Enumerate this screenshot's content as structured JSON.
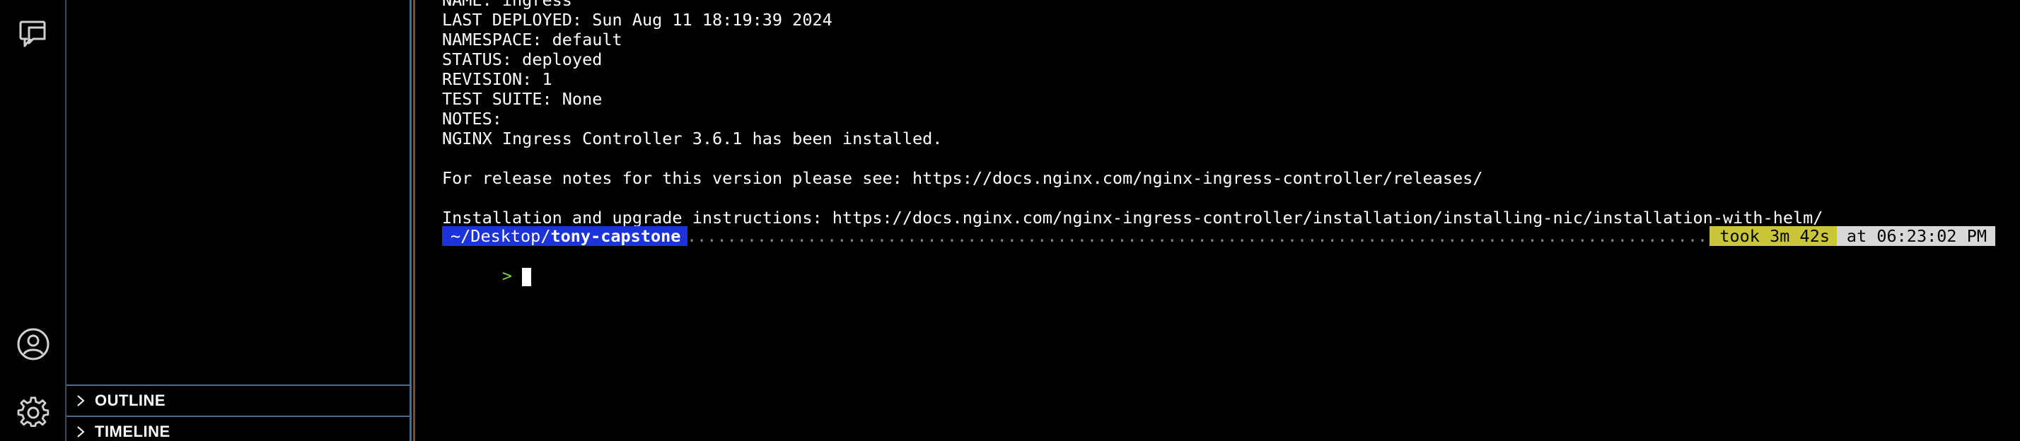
{
  "activity_bar": {
    "icons": [
      "chat-icon",
      "account-icon",
      "settings-icon"
    ]
  },
  "side_panel": {
    "sections": [
      {
        "label": "OUTLINE"
      },
      {
        "label": "TIMELINE"
      }
    ]
  },
  "terminal": {
    "lines": [
      "NAME: ingress",
      "LAST DEPLOYED: Sun Aug 11 18:19:39 2024",
      "NAMESPACE: default",
      "STATUS: deployed",
      "REVISION: 1",
      "TEST SUITE: None",
      "NOTES:",
      "NGINX Ingress Controller 3.6.1 has been installed.",
      "",
      "For release notes for this version please see: https://docs.nginx.com/nginx-ingress-controller/releases/",
      "",
      "Installation and upgrade instructions: https://docs.nginx.com/nginx-ingress-controller/installation/installing-nic/installation-with-helm/"
    ],
    "prompt": {
      "path_prefix": "~/Desktop/",
      "path_dir": "tony-capstone",
      "dots": "................................................................................................................................................................................................................",
      "took": "took 3m 42s",
      "at": "at 06:23:02 PM",
      "caret": ">"
    }
  },
  "colors": {
    "path_bg": "#1c33d9",
    "took_bg": "#c9c63a",
    "at_bg": "#d8d8d8",
    "caret": "#7ecf4a"
  }
}
